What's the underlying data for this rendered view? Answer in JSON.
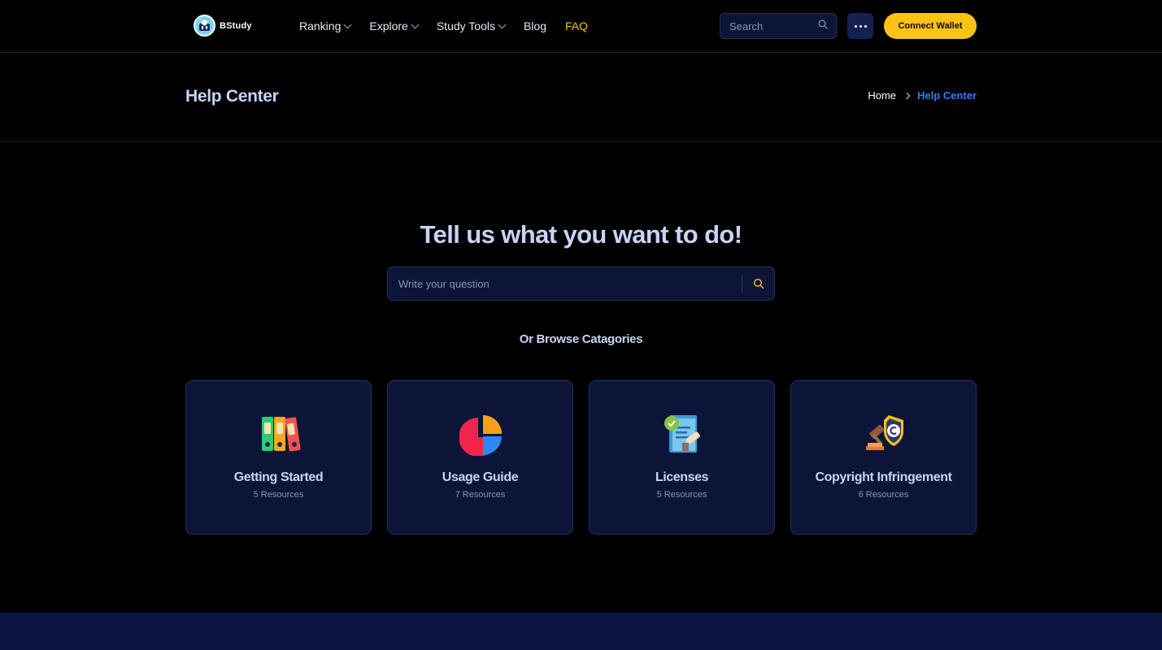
{
  "header": {
    "logo_text": "BStudy",
    "nav": [
      {
        "label": "Ranking",
        "has_dropdown": true
      },
      {
        "label": "Explore",
        "has_dropdown": true
      },
      {
        "label": "Study Tools",
        "has_dropdown": true
      },
      {
        "label": "Blog",
        "has_dropdown": false
      },
      {
        "label": "FAQ",
        "has_dropdown": false,
        "active": true
      }
    ],
    "search_placeholder": "Search",
    "more_icon": "more-horizontal-icon",
    "connect_wallet_label": "Connect Wallet"
  },
  "titlebar": {
    "page_title": "Help Center",
    "breadcrumb": {
      "home": "Home",
      "current": "Help Center"
    }
  },
  "hero": {
    "title": "Tell us what you want to do!",
    "question_placeholder": "Write your question",
    "browse_title": "Or Browse Catagories"
  },
  "categories": [
    {
      "title": "Getting Started",
      "count": "5 Resources",
      "icon": "binders-icon"
    },
    {
      "title": "Usage Guide",
      "count": "7 Resources",
      "icon": "pie-chart-icon"
    },
    {
      "title": "Licenses",
      "count": "5 Resources",
      "icon": "certificate-icon"
    },
    {
      "title": "Copyright Infringement",
      "count": "6 Resources",
      "icon": "gavel-copyright-icon"
    }
  ],
  "colors": {
    "background": "#000000",
    "card_bg": "#0c1538",
    "accent_yellow": "#fcc315",
    "accent_blue": "#2f7df6",
    "text": "#c9d3f5"
  }
}
